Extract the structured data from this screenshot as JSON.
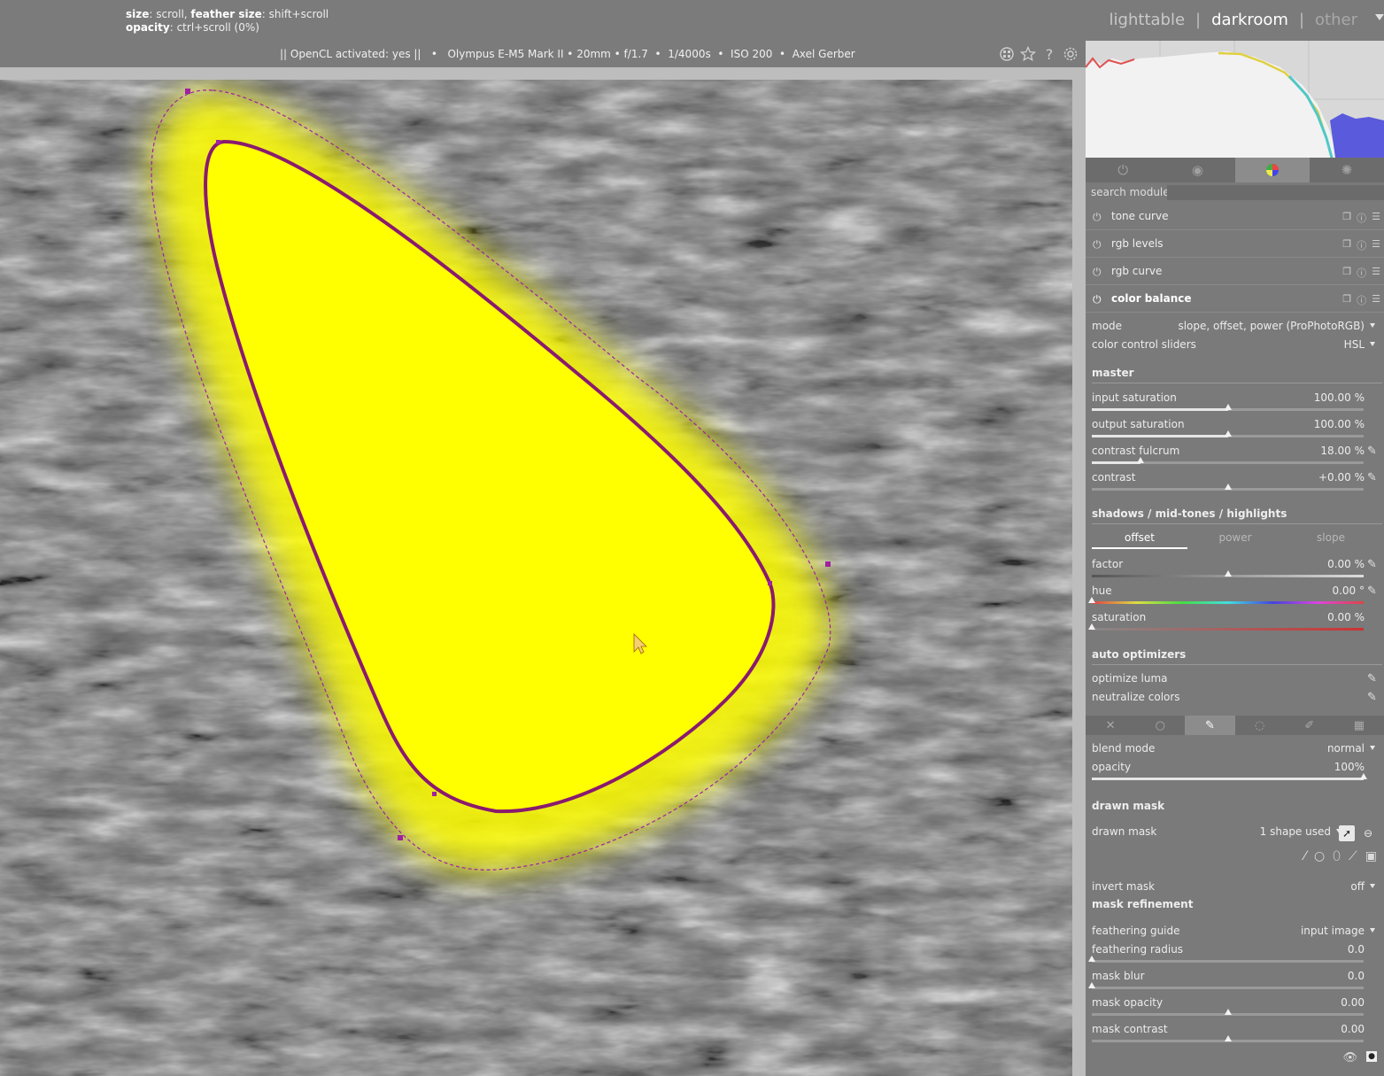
{
  "hints": {
    "line1_size_key": "size",
    "line1_size_val": ": scroll, ",
    "line1_feather_key": "feather size",
    "line1_feather_val": ": shift+scroll",
    "line2_opacity_key": "opacity",
    "line2_opacity_val": ": ctrl+scroll (0%)"
  },
  "views": {
    "lighttable": "lighttable",
    "darkroom": "darkroom",
    "other": "other",
    "sep": "|"
  },
  "info_line": "|| OpenCL activated: yes ||   •   Olympus E-M5 Mark II • 20mm • f/1.7  •  1/4000s  •  ISO 200  •  Axel Gerber",
  "top_icons": [
    "grouping-icon",
    "star-icon",
    "help-icon",
    "gear-icon"
  ],
  "module_groups": [
    "power-icon",
    "base-icon",
    "color-icon",
    "effects-icon"
  ],
  "search": {
    "label": "search module",
    "value": ""
  },
  "modules": [
    {
      "name": "tone curve"
    },
    {
      "name": "rgb levels"
    },
    {
      "name": "rgb curve"
    },
    {
      "name": "color balance"
    }
  ],
  "color_balance": {
    "mode_label": "mode",
    "mode_value": "slope, offset, power (ProPhotoRGB)",
    "ccs_label": "color control sliders",
    "ccs_value": "HSL",
    "master_title": "master",
    "input_saturation": {
      "label": "input saturation",
      "value": "100.00 %",
      "pos": 0.5
    },
    "output_saturation": {
      "label": "output saturation",
      "value": "100.00 %",
      "pos": 0.5
    },
    "contrast_fulcrum": {
      "label": "contrast fulcrum",
      "value": "18.00 %",
      "pos": 0.18
    },
    "contrast": {
      "label": "contrast",
      "value": "+0.00 %",
      "pos": 0.5
    },
    "smh_title": "shadows / mid-tones / highlights",
    "tabs": [
      "offset",
      "power",
      "slope"
    ],
    "factor": {
      "label": "factor",
      "value": "0.00 %",
      "pos": 0.5
    },
    "hue": {
      "label": "hue",
      "value": "0.00 °",
      "pos": 0.0
    },
    "saturation": {
      "label": "saturation",
      "value": "0.00 %",
      "pos": 0.0
    },
    "auto_title": "auto optimizers",
    "optimize_luma": "optimize luma",
    "neutralize_colors": "neutralize colors"
  },
  "blend": {
    "tabs": [
      "off-icon",
      "uniform-icon",
      "drawn-icon",
      "parametric-icon",
      "drawn-parametric-icon",
      "raster-icon"
    ],
    "blend_mode_label": "blend mode",
    "blend_mode_value": "normal",
    "opacity_label": "opacity",
    "opacity_value": "100%",
    "opacity_pos": 1.0,
    "drawn_mask_title": "drawn mask",
    "drawn_mask_label": "drawn mask",
    "drawn_mask_value": "1 shape used",
    "invert_label": "invert mask",
    "invert_value": "off",
    "refine_title": "mask refinement",
    "guide_label": "feathering guide",
    "guide_value": "input image",
    "radius": {
      "label": "feathering radius",
      "value": "0.0",
      "pos": 0.0
    },
    "blur": {
      "label": "mask blur",
      "value": "0.0",
      "pos": 0.0
    },
    "mopacity": {
      "label": "mask opacity",
      "value": "0.00",
      "pos": 0.5
    },
    "mcontrast": {
      "label": "mask contrast",
      "value": "0.00",
      "pos": 0.5
    }
  },
  "colors": {
    "mask": "#ffff00",
    "shape_line": "#8a1a6e",
    "feather_line": "#a020a0"
  }
}
